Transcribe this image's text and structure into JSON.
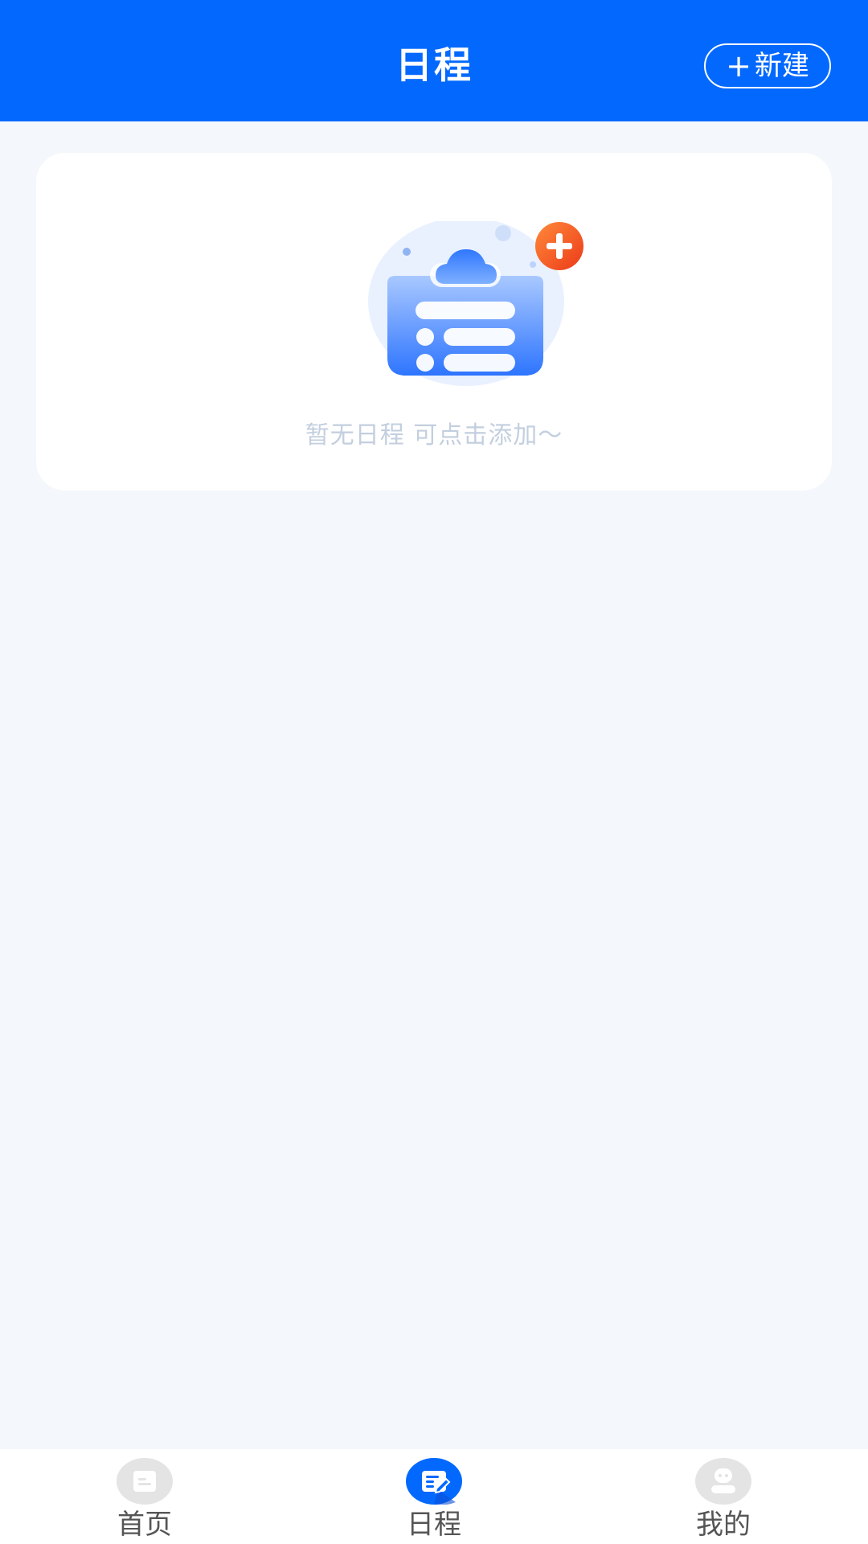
{
  "header": {
    "title": "日程",
    "new_button": {
      "icon": "plus-icon",
      "label": "新建"
    }
  },
  "empty_state": {
    "icon": "schedule-clipboard-add-icon",
    "message": "暂无日程 可点击添加～"
  },
  "tabbar": {
    "items": [
      {
        "label": "首页",
        "icon": "home-doc-icon",
        "active": false
      },
      {
        "label": "日程",
        "icon": "schedule-edit-icon",
        "active": true
      },
      {
        "label": "我的",
        "icon": "profile-icon",
        "active": false
      }
    ]
  },
  "colors": {
    "brand": "#0369fe",
    "background": "#f4f7fb",
    "empty_text": "#c3cfdf",
    "inactive_icon": "#e4e4e4",
    "accent_add": "#f5541e"
  }
}
